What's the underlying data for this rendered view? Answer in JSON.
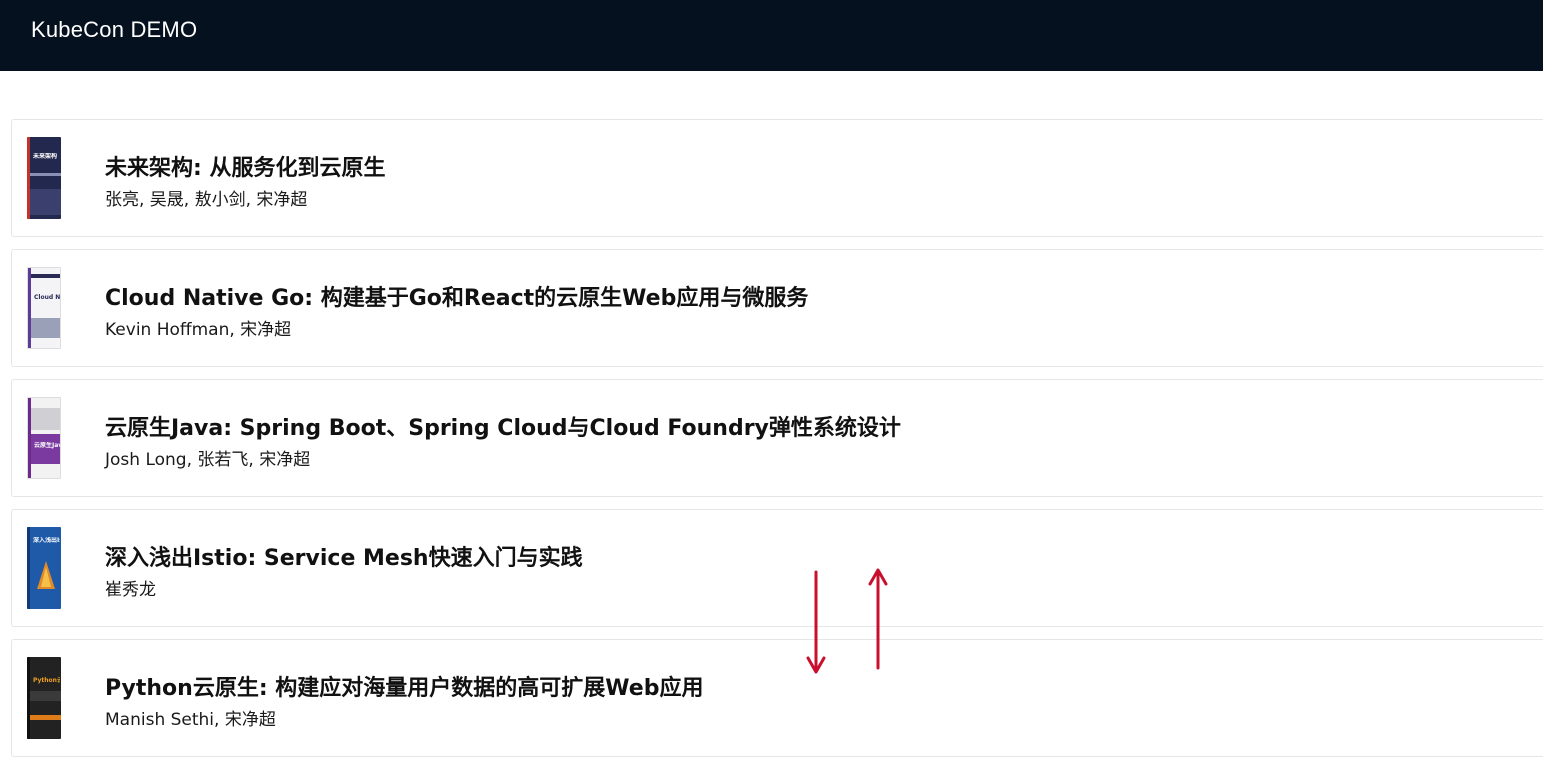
{
  "header": {
    "title": "KubeCon DEMO"
  },
  "books": [
    {
      "title": "未来架构: 从服务化到云原生",
      "authors": "张亮, 吴晟, 敖小剑, 宋净超",
      "cover_text": "未来架构",
      "cover_colors": {
        "bg": "#23284f",
        "spine": "#c4322c",
        "text": "#ffffff",
        "band": "#8a8fb5"
      }
    },
    {
      "title": "Cloud Native Go: 构建基于Go和React的云原生Web应用与微服务",
      "authors": "Kevin Hoffman, 宋净超",
      "cover_text": "Cloud Native Go",
      "cover_colors": {
        "bg": "#f4f4f6",
        "spine": "#5b3d97",
        "text": "#2a2a55",
        "band": "#9aa0b8"
      }
    },
    {
      "title": "云原生Java: Spring Boot、Spring Cloud与Cloud Foundry弹性系统设计",
      "authors": "Josh Long, 张若飞, 宋净超",
      "cover_text": "云原生Java",
      "cover_colors": {
        "bg": "#f2f2f2",
        "spine": "#6b2a8c",
        "text": "#ffffff",
        "band": "#7a3aa0"
      }
    },
    {
      "title": "深入浅出Istio: Service Mesh快速入门与实践",
      "authors": "崔秀龙",
      "cover_text": "深入浅出Istio",
      "cover_colors": {
        "bg": "#1f5aa8",
        "spine": "#123a78",
        "text": "#ffffff",
        "band": "#e08a2a"
      }
    },
    {
      "title": "Python云原生: 构建应对海量用户数据的高可扩展Web应用",
      "authors": "Manish Sethi, 宋净超",
      "cover_text": "Python云原生",
      "cover_colors": {
        "bg": "#222222",
        "spine": "#111111",
        "text": "#f0a020",
        "band": "#e07b1a"
      }
    }
  ],
  "annotations": {
    "arrow_color": "#c8102e",
    "arrows": [
      "scroll-down-arrow",
      "scroll-up-arrow"
    ]
  }
}
